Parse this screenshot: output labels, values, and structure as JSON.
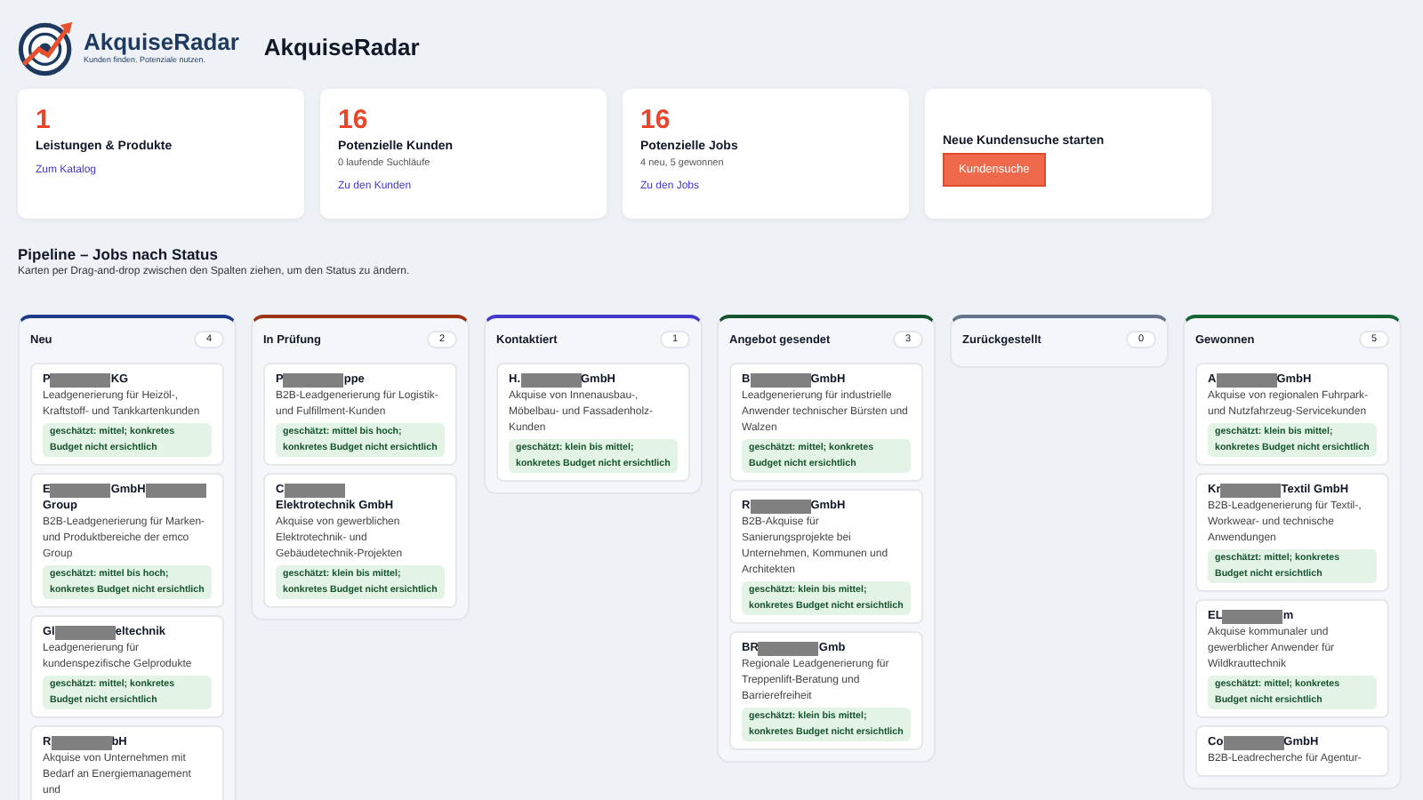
{
  "logo": {
    "name": "AkquiseRadar",
    "tagline": "Kunden finden. Potenziale nutzen."
  },
  "title": "AkquiseRadar",
  "stats": [
    {
      "value": "1",
      "label": "Leistungen & Produkte",
      "link": "Zum Katalog"
    },
    {
      "value": "16",
      "label": "Potenzielle Kunden",
      "note": "0 laufende Suchläufe",
      "link": "Zu den Kunden"
    },
    {
      "value": "16",
      "label": "Potenzielle Jobs",
      "note": "4 neu, 5 gewonnen",
      "link": "Zu den Jobs"
    }
  ],
  "action": {
    "title": "Neue Kundensuche starten",
    "button": "Kundensuche"
  },
  "pipeline": {
    "title": "Pipeline – Jobs nach Status",
    "subtitle": "Karten per Drag-and-drop zwischen den Spalten ziehen, um den Status zu ändern."
  },
  "columns": [
    {
      "name": "Neu",
      "count": "4",
      "color": "#1e3a8a",
      "cards": [
        {
          "name_parts": [
            "P",
            "KG"
          ],
          "description": "Leadgenerierung für Heizöl-, Kraftstoff- und Tankkartenkunden",
          "estimate": "geschätzt: mittel; konkretes Budget nicht ersichtlich"
        },
        {
          "name_parts": [
            "E",
            "GmbH",
            "Group"
          ],
          "description": "B2B-Leadgenerierung für Marken- und Produktbereiche der emco Group",
          "estimate": "geschätzt: mittel bis hoch; konkretes Budget nicht ersichtlich"
        },
        {
          "name_parts": [
            "Gl",
            "eltechnik"
          ],
          "description": "Leadgenerierung für kundenspezifische Gelprodukte",
          "estimate": "geschätzt: mittel; konkretes Budget nicht ersichtlich"
        },
        {
          "name_parts": [
            "R",
            "bH"
          ],
          "description": "Akquise von Unternehmen mit Bedarf an Energiemanagement und"
        }
      ]
    },
    {
      "name": "In Prüfung",
      "count": "2",
      "color": "#9a3412",
      "cards": [
        {
          "name_parts": [
            "P",
            "ppe"
          ],
          "description": "B2B-Leadgenerierung für Logistik- und Fulfillment-Kunden",
          "estimate": "geschätzt: mittel bis hoch; konkretes Budget nicht ersichtlich"
        },
        {
          "name_parts": [
            "C",
            "Elektrotechnik GmbH"
          ],
          "description": "Akquise von gewerblichen Elektrotechnik- und Gebäudetechnik-Projekten",
          "estimate": "geschätzt: klein bis mittel; konkretes Budget nicht ersichtlich"
        }
      ]
    },
    {
      "name": "Kontaktiert",
      "count": "1",
      "color": "#4338ca",
      "cards": [
        {
          "name_parts": [
            "H.",
            "GmbH"
          ],
          "description": "Akquise von Innenausbau-, Möbelbau- und Fassadenholz-Kunden",
          "estimate": "geschätzt: klein bis mittel; konkretes Budget nicht ersichtlich"
        }
      ]
    },
    {
      "name": "Angebot gesendet",
      "count": "3",
      "color": "#14532d",
      "cards": [
        {
          "name_parts": [
            "B",
            "GmbH"
          ],
          "description": "Leadgenerierung für industrielle Anwender technischer Bürsten und Walzen",
          "estimate": "geschätzt: mittel; konkretes Budget nicht ersichtlich"
        },
        {
          "name_parts": [
            "R",
            "GmbH"
          ],
          "description": "B2B-Akquise für Sanierungsprojekte bei Unternehmen, Kommunen und Architekten",
          "estimate": "geschätzt: klein bis mittel; konkretes Budget nicht ersichtlich"
        },
        {
          "name_parts": [
            "BR",
            "Gmb"
          ],
          "description": "Regionale Leadgenerierung für Treppenlift-Beratung und Barrierefreiheit",
          "estimate": "geschätzt: klein bis mittel; konkretes Budget nicht ersichtlich"
        }
      ]
    },
    {
      "name": "Zurückgestellt",
      "count": "0",
      "color": "#64748b"
    },
    {
      "name": "Gewonnen",
      "count": "5",
      "color": "#166534",
      "cards": [
        {
          "name_parts": [
            "A",
            "GmbH"
          ],
          "description": "Akquise von regionalen Fuhrpark- und Nutzfahrzeug-Servicekunden",
          "estimate": "geschätzt: klein bis mittel; konkretes Budget nicht ersichtlich"
        },
        {
          "name_parts": [
            "Kr",
            "Textil GmbH"
          ],
          "description": "B2B-Leadgenerierung für Textil-, Workwear- und technische Anwendungen",
          "estimate": "geschätzt: mittel; konkretes Budget nicht ersichtlich"
        },
        {
          "name_parts": [
            "EL",
            "m"
          ],
          "description": "Akquise kommunaler und gewerblicher Anwender für Wildkrauttechnik",
          "estimate": "geschätzt: mittel; konkretes Budget nicht ersichtlich"
        },
        {
          "name_parts": [
            "Co",
            "GmbH"
          ],
          "description": "B2B-Leadrecherche für Agentur-"
        }
      ]
    }
  ]
}
